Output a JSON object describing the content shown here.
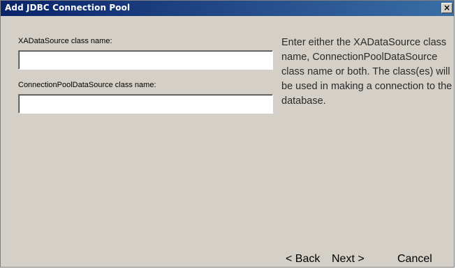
{
  "window": {
    "title": "Add JDBC Connection Pool",
    "close_label": "×"
  },
  "form": {
    "xa_label": "XADataSource class name:",
    "xa_value": "",
    "cp_label": "ConnectionPoolDataSource class name:",
    "cp_value": ""
  },
  "help": {
    "text": "Enter either the XADataSource class name, ConnectionPoolDataSource class name or both.  The class(es) will be used in making a connection to the database."
  },
  "buttons": {
    "back": "< Back",
    "next": "Next >",
    "cancel": "Cancel"
  }
}
